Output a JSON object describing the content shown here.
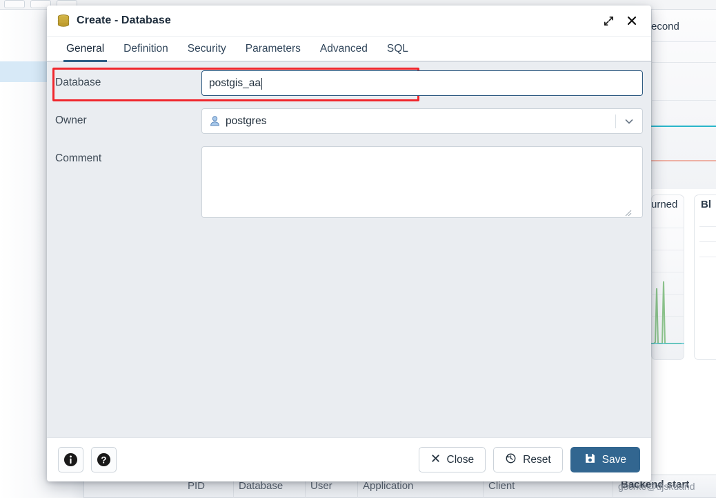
{
  "background": {
    "app": "pgAdmin dashboard",
    "right_panel_title": "econd",
    "cards": [
      {
        "title": "urned"
      },
      {
        "title": "Bl"
      }
    ],
    "session_table": {
      "columns": [
        "PID",
        "Database",
        "User",
        "Application",
        "Client"
      ],
      "overlap_text_1": "Backend start",
      "overlap_text_2": "gscrxe@djskdand"
    }
  },
  "dialog": {
    "title": "Create - Database",
    "title_icon": "database-icon",
    "window_controls": {
      "expand": "expand-icon",
      "close": "close-icon"
    },
    "tabs": [
      {
        "label": "General",
        "active": true
      },
      {
        "label": "Definition",
        "active": false
      },
      {
        "label": "Security",
        "active": false
      },
      {
        "label": "Parameters",
        "active": false
      },
      {
        "label": "Advanced",
        "active": false
      },
      {
        "label": "SQL",
        "active": false
      }
    ],
    "form": {
      "database": {
        "label": "Database",
        "value": "postgis_aa",
        "placeholder": "",
        "focused": true,
        "highlighted": true
      },
      "owner": {
        "label": "Owner",
        "value": "postgres",
        "icon": "user-icon",
        "chevron": "chevron-down-icon"
      },
      "comment": {
        "label": "Comment",
        "value": "",
        "placeholder": ""
      }
    },
    "footer": {
      "info_label": "i",
      "help_label": "?",
      "close_label": "Close",
      "reset_label": "Reset",
      "save_label": "Save"
    }
  },
  "colors": {
    "accent_blue": "#326690",
    "tab_underline": "#2d5f85",
    "annotation_red": "#f0262c",
    "focus_border": "#2f5b82",
    "body_bg": "#eaedf1",
    "db_icon_gold": "#c9a227"
  }
}
